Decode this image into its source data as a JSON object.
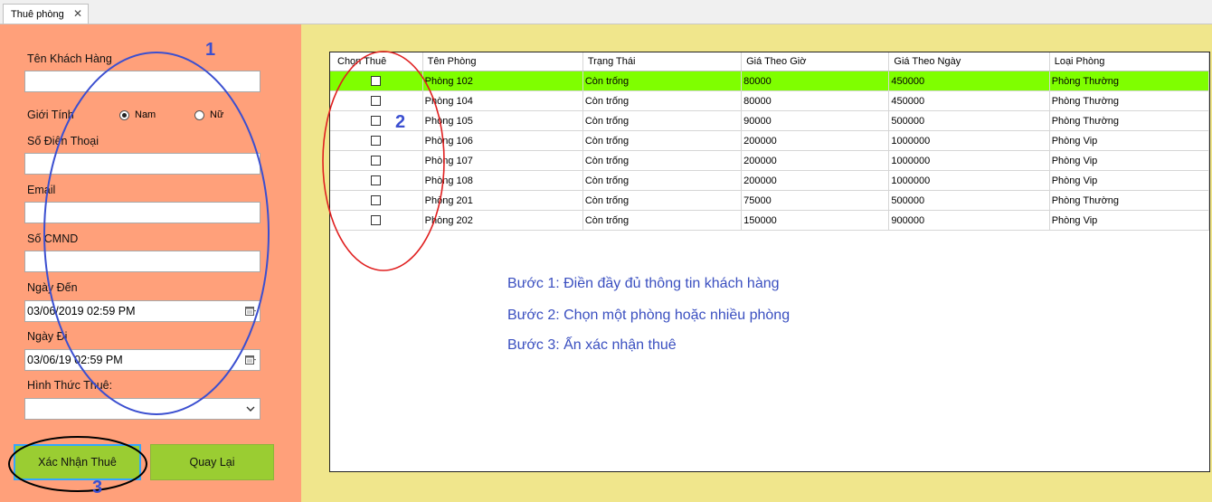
{
  "tab": {
    "label": "Thuê phòng",
    "close_glyph": "✕"
  },
  "form": {
    "customer_name_label": "Tên Khách Hàng",
    "customer_name_value": "",
    "gender_label": "Giới Tính",
    "gender_options": [
      "Nam",
      "Nữ"
    ],
    "gender_selected": "Nam",
    "phone_label": "Số Điện Thoại",
    "phone_value": "",
    "email_label": "Email",
    "email_value": "",
    "id_label": "Số CMND",
    "id_value": "",
    "arrival_label": "Ngày Đến",
    "arrival_value": "03/06/2019 02:59 PM",
    "departure_label": "Ngày Đi",
    "departure_value": "03/06/19 02:59 PM",
    "rental_type_label": "Hình Thức Thuê:",
    "rental_type_value": ""
  },
  "buttons": {
    "confirm": "Xác Nhận Thuê",
    "back": "Quay Lại"
  },
  "grid": {
    "columns": [
      "Chọn Thuê",
      "Tên Phòng",
      "Trạng Thái",
      "Giá Theo Giờ",
      "Giá Theo Ngày",
      "Loại Phòng"
    ],
    "rows": [
      {
        "checked": false,
        "name": "Phòng 102",
        "status": "Còn trống",
        "hour_price": "80000",
        "day_price": "450000",
        "type": "Phòng Thường",
        "selected": true
      },
      {
        "checked": false,
        "name": "Phòng 104",
        "status": "Còn trống",
        "hour_price": "80000",
        "day_price": "450000",
        "type": "Phòng Thường"
      },
      {
        "checked": false,
        "name": "Phòng 105",
        "status": "Còn trống",
        "hour_price": "90000",
        "day_price": "500000",
        "type": "Phòng Thường"
      },
      {
        "checked": false,
        "name": "Phòng 106",
        "status": "Còn trống",
        "hour_price": "200000",
        "day_price": "1000000",
        "type": "Phòng Vip"
      },
      {
        "checked": false,
        "name": "Phòng 107",
        "status": "Còn trống",
        "hour_price": "200000",
        "day_price": "1000000",
        "type": "Phòng Vip"
      },
      {
        "checked": false,
        "name": "Phòng 108",
        "status": "Còn trống",
        "hour_price": "200000",
        "day_price": "1000000",
        "type": "Phòng Vip"
      },
      {
        "checked": false,
        "name": "Phòng 201",
        "status": "Còn trống",
        "hour_price": "75000",
        "day_price": "500000",
        "type": "Phòng Thường"
      },
      {
        "checked": false,
        "name": "Phòng 202",
        "status": "Còn trống",
        "hour_price": "150000",
        "day_price": "900000",
        "type": "Phòng Vip"
      }
    ]
  },
  "instructions": {
    "step1": "Bước 1: Điền đầy đủ thông tin khách hàng",
    "step2": "Bước 2: Chọn một phòng hoặc nhiều  phòng",
    "step3": "Bước 3: Ấn xác nhận thuê"
  },
  "annotations": {
    "n1": "1",
    "n2": "2",
    "n3": "3"
  },
  "colors": {
    "left_panel": "#ffa07a",
    "right_panel": "#f0e68c",
    "button_green": "#9acd32",
    "selected_row": "#7fff00",
    "annotation_blue": "#3b4fd0",
    "annotation_red": "#e02020",
    "annotation_black": "#000000"
  },
  "icons": [
    "close-icon",
    "calendar-icon",
    "dropdown-arrow-icon",
    "checkbox"
  ]
}
